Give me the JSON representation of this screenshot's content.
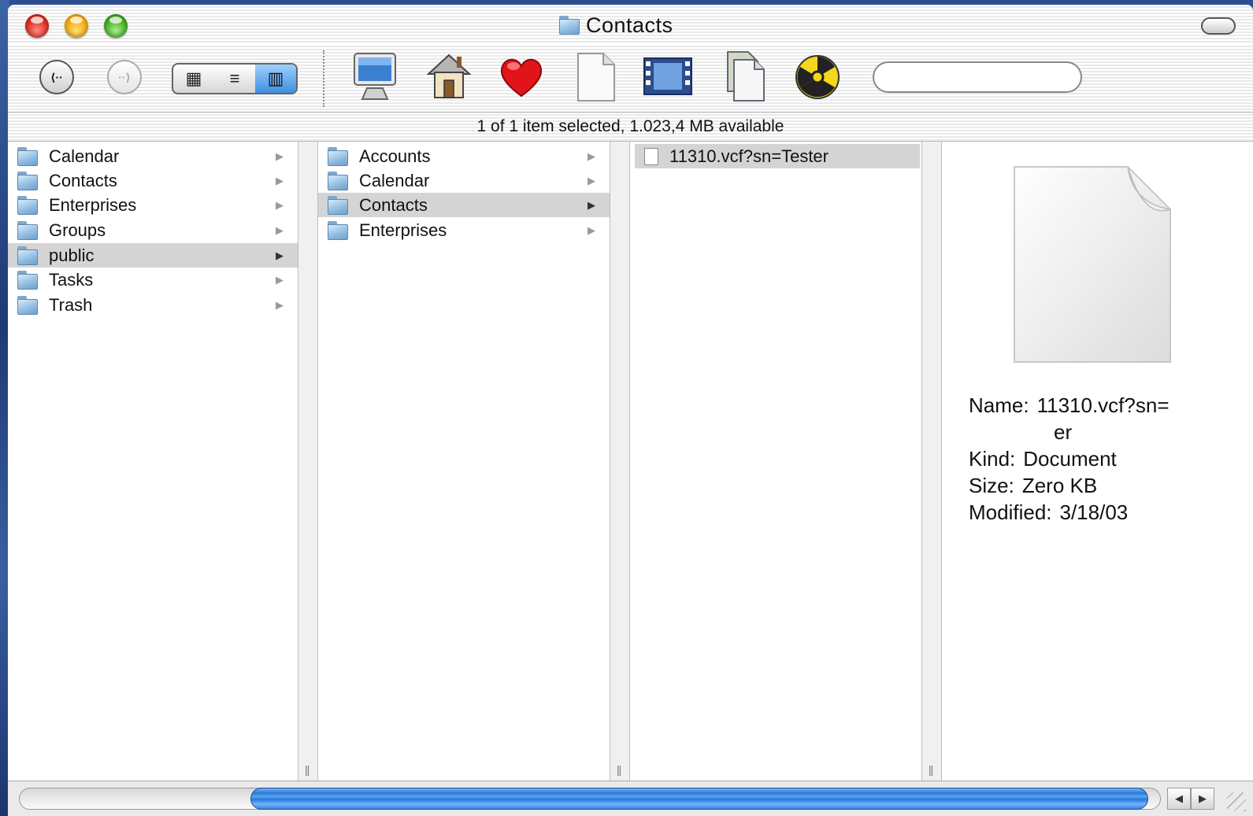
{
  "window": {
    "title": "Contacts"
  },
  "status": {
    "text": "1 of 1 item selected, 1.023,4 MB available"
  },
  "toolbar": {
    "back_glyph": "⟨··",
    "forward_glyph": "··⟩",
    "views": [
      {
        "name": "icon-view",
        "glyph": "▦"
      },
      {
        "name": "list-view",
        "glyph": "≡"
      },
      {
        "name": "column-view",
        "glyph": "▥"
      }
    ],
    "icons": [
      "computer-icon",
      "home-icon",
      "favorites-icon",
      "document-icon",
      "movies-icon",
      "applications-icon",
      "burn-icon"
    ],
    "search_placeholder": ""
  },
  "columns": [
    {
      "items": [
        {
          "label": "Calendar",
          "selected": false
        },
        {
          "label": "Contacts",
          "selected": false
        },
        {
          "label": "Enterprises",
          "selected": false
        },
        {
          "label": "Groups",
          "selected": false
        },
        {
          "label": "public",
          "selected": true
        },
        {
          "label": "Tasks",
          "selected": false
        },
        {
          "label": "Trash",
          "selected": false
        }
      ]
    },
    {
      "items": [
        {
          "label": "Accounts",
          "selected": false
        },
        {
          "label": "Calendar",
          "selected": false
        },
        {
          "label": "Contacts",
          "selected": true
        },
        {
          "label": "Enterprises",
          "selected": false
        }
      ]
    },
    {
      "items": [
        {
          "label": "11310.vcf?sn=Tester",
          "selected": true
        }
      ]
    }
  ],
  "preview": {
    "name_label": "Name:",
    "name_value": "11310.vcf?sn=",
    "name_cont": "er",
    "kind_label": "Kind:",
    "kind_value": "Document",
    "size_label": "Size:",
    "size_value": "Zero KB",
    "modified_label": "Modified:",
    "modified_value": "3/18/03"
  },
  "scrollbar": {
    "left_arrow": "◀",
    "right_arrow": "▶"
  },
  "colors": {
    "selection": "#d4d4d4",
    "scroll_thumb": "#2b79d6",
    "desktop": "#2d4f8f"
  }
}
